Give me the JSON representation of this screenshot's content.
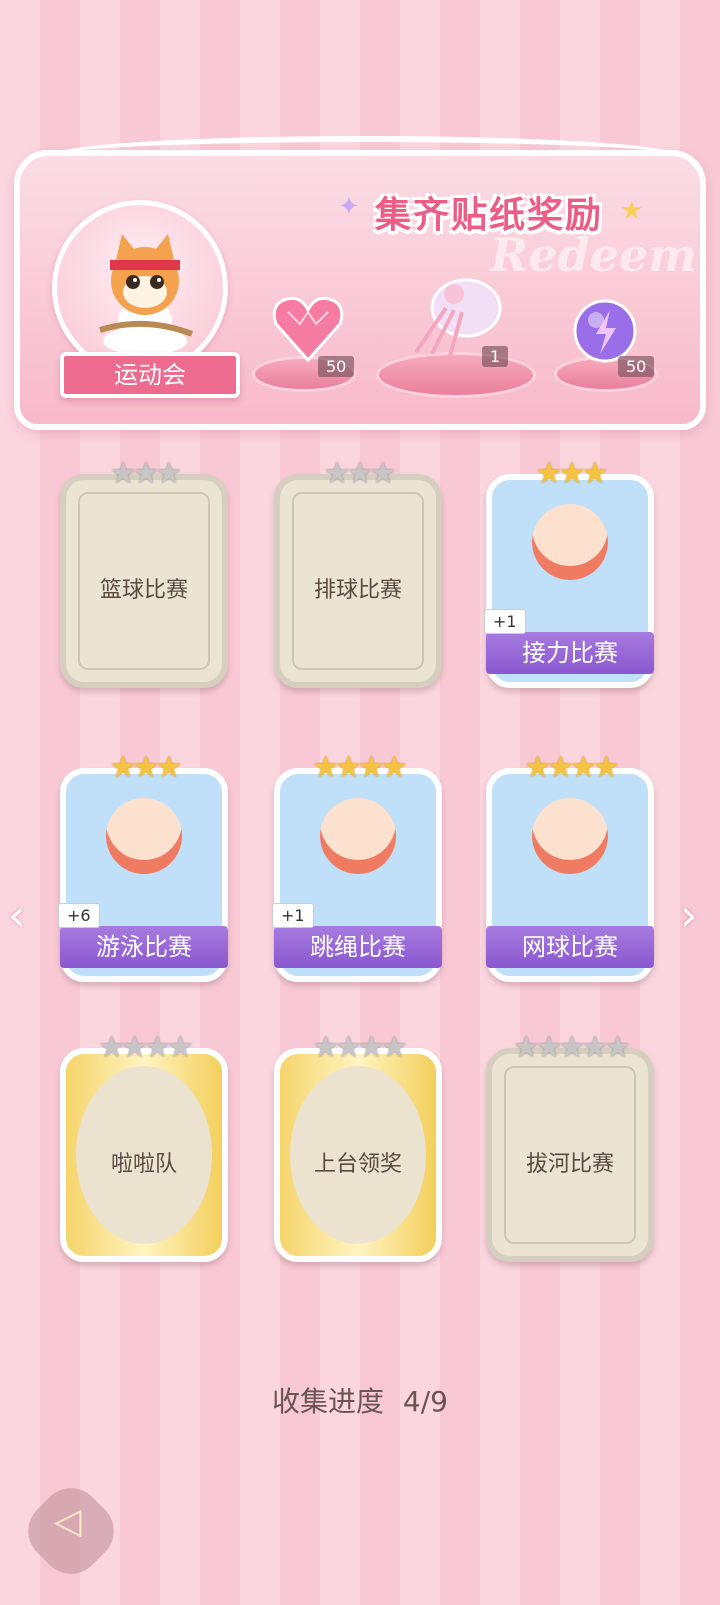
{
  "banner": {
    "title": "集齐贴纸奖励",
    "watermark": "Redeem",
    "event_name": "运动会",
    "rewards": [
      {
        "icon": "heart-gem-icon",
        "count": "50"
      },
      {
        "icon": "ribbon-bow-icon",
        "count": "1"
      },
      {
        "icon": "lightning-orb-icon",
        "count": "50"
      }
    ]
  },
  "cards": [
    {
      "name": "篮球比赛",
      "stars": 3,
      "earned": 0,
      "collected": false,
      "frame": "plain",
      "bonus": ""
    },
    {
      "name": "排球比赛",
      "stars": 3,
      "earned": 0,
      "collected": false,
      "frame": "plain",
      "bonus": ""
    },
    {
      "name": "接力比赛",
      "stars": 3,
      "earned": 3,
      "collected": true,
      "frame": "photo",
      "bonus": "+1"
    },
    {
      "name": "游泳比赛",
      "stars": 3,
      "earned": 3,
      "collected": true,
      "frame": "photo",
      "bonus": "+6"
    },
    {
      "name": "跳绳比赛",
      "stars": 4,
      "earned": 4,
      "collected": true,
      "frame": "photo",
      "bonus": "+1"
    },
    {
      "name": "网球比赛",
      "stars": 4,
      "earned": 4,
      "collected": true,
      "frame": "photo",
      "bonus": ""
    },
    {
      "name": "啦啦队",
      "stars": 4,
      "earned": 0,
      "collected": false,
      "frame": "gold",
      "bonus": ""
    },
    {
      "name": "上台领奖",
      "stars": 4,
      "earned": 0,
      "collected": false,
      "frame": "gold",
      "bonus": ""
    },
    {
      "name": "拔河比赛",
      "stars": 5,
      "earned": 0,
      "collected": false,
      "frame": "plain",
      "bonus": ""
    }
  ],
  "progress": {
    "label": "收集进度",
    "value": "4/9"
  },
  "colors": {
    "accent": "#ec5d86",
    "name_bar": "#8a58cf",
    "star_gold": "#f5c342"
  }
}
